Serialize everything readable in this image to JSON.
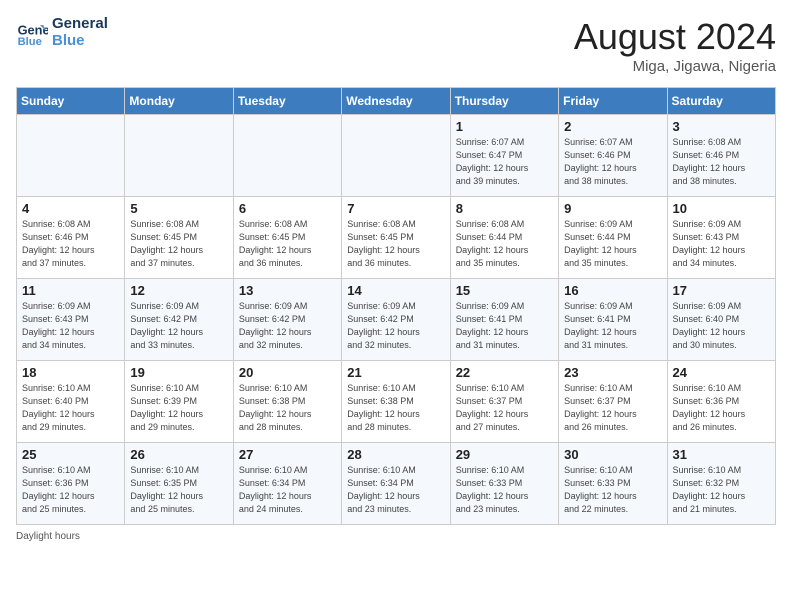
{
  "logo": {
    "line1": "General",
    "line2": "Blue"
  },
  "title": "August 2024",
  "subtitle": "Miga, Jigawa, Nigeria",
  "days_of_week": [
    "Sunday",
    "Monday",
    "Tuesday",
    "Wednesday",
    "Thursday",
    "Friday",
    "Saturday"
  ],
  "weeks": [
    [
      {
        "num": "",
        "info": ""
      },
      {
        "num": "",
        "info": ""
      },
      {
        "num": "",
        "info": ""
      },
      {
        "num": "",
        "info": ""
      },
      {
        "num": "1",
        "info": "Sunrise: 6:07 AM\nSunset: 6:47 PM\nDaylight: 12 hours\nand 39 minutes."
      },
      {
        "num": "2",
        "info": "Sunrise: 6:07 AM\nSunset: 6:46 PM\nDaylight: 12 hours\nand 38 minutes."
      },
      {
        "num": "3",
        "info": "Sunrise: 6:08 AM\nSunset: 6:46 PM\nDaylight: 12 hours\nand 38 minutes."
      }
    ],
    [
      {
        "num": "4",
        "info": "Sunrise: 6:08 AM\nSunset: 6:46 PM\nDaylight: 12 hours\nand 37 minutes."
      },
      {
        "num": "5",
        "info": "Sunrise: 6:08 AM\nSunset: 6:45 PM\nDaylight: 12 hours\nand 37 minutes."
      },
      {
        "num": "6",
        "info": "Sunrise: 6:08 AM\nSunset: 6:45 PM\nDaylight: 12 hours\nand 36 minutes."
      },
      {
        "num": "7",
        "info": "Sunrise: 6:08 AM\nSunset: 6:45 PM\nDaylight: 12 hours\nand 36 minutes."
      },
      {
        "num": "8",
        "info": "Sunrise: 6:08 AM\nSunset: 6:44 PM\nDaylight: 12 hours\nand 35 minutes."
      },
      {
        "num": "9",
        "info": "Sunrise: 6:09 AM\nSunset: 6:44 PM\nDaylight: 12 hours\nand 35 minutes."
      },
      {
        "num": "10",
        "info": "Sunrise: 6:09 AM\nSunset: 6:43 PM\nDaylight: 12 hours\nand 34 minutes."
      }
    ],
    [
      {
        "num": "11",
        "info": "Sunrise: 6:09 AM\nSunset: 6:43 PM\nDaylight: 12 hours\nand 34 minutes."
      },
      {
        "num": "12",
        "info": "Sunrise: 6:09 AM\nSunset: 6:42 PM\nDaylight: 12 hours\nand 33 minutes."
      },
      {
        "num": "13",
        "info": "Sunrise: 6:09 AM\nSunset: 6:42 PM\nDaylight: 12 hours\nand 32 minutes."
      },
      {
        "num": "14",
        "info": "Sunrise: 6:09 AM\nSunset: 6:42 PM\nDaylight: 12 hours\nand 32 minutes."
      },
      {
        "num": "15",
        "info": "Sunrise: 6:09 AM\nSunset: 6:41 PM\nDaylight: 12 hours\nand 31 minutes."
      },
      {
        "num": "16",
        "info": "Sunrise: 6:09 AM\nSunset: 6:41 PM\nDaylight: 12 hours\nand 31 minutes."
      },
      {
        "num": "17",
        "info": "Sunrise: 6:09 AM\nSunset: 6:40 PM\nDaylight: 12 hours\nand 30 minutes."
      }
    ],
    [
      {
        "num": "18",
        "info": "Sunrise: 6:10 AM\nSunset: 6:40 PM\nDaylight: 12 hours\nand 29 minutes."
      },
      {
        "num": "19",
        "info": "Sunrise: 6:10 AM\nSunset: 6:39 PM\nDaylight: 12 hours\nand 29 minutes."
      },
      {
        "num": "20",
        "info": "Sunrise: 6:10 AM\nSunset: 6:38 PM\nDaylight: 12 hours\nand 28 minutes."
      },
      {
        "num": "21",
        "info": "Sunrise: 6:10 AM\nSunset: 6:38 PM\nDaylight: 12 hours\nand 28 minutes."
      },
      {
        "num": "22",
        "info": "Sunrise: 6:10 AM\nSunset: 6:37 PM\nDaylight: 12 hours\nand 27 minutes."
      },
      {
        "num": "23",
        "info": "Sunrise: 6:10 AM\nSunset: 6:37 PM\nDaylight: 12 hours\nand 26 minutes."
      },
      {
        "num": "24",
        "info": "Sunrise: 6:10 AM\nSunset: 6:36 PM\nDaylight: 12 hours\nand 26 minutes."
      }
    ],
    [
      {
        "num": "25",
        "info": "Sunrise: 6:10 AM\nSunset: 6:36 PM\nDaylight: 12 hours\nand 25 minutes."
      },
      {
        "num": "26",
        "info": "Sunrise: 6:10 AM\nSunset: 6:35 PM\nDaylight: 12 hours\nand 25 minutes."
      },
      {
        "num": "27",
        "info": "Sunrise: 6:10 AM\nSunset: 6:34 PM\nDaylight: 12 hours\nand 24 minutes."
      },
      {
        "num": "28",
        "info": "Sunrise: 6:10 AM\nSunset: 6:34 PM\nDaylight: 12 hours\nand 23 minutes."
      },
      {
        "num": "29",
        "info": "Sunrise: 6:10 AM\nSunset: 6:33 PM\nDaylight: 12 hours\nand 23 minutes."
      },
      {
        "num": "30",
        "info": "Sunrise: 6:10 AM\nSunset: 6:33 PM\nDaylight: 12 hours\nand 22 minutes."
      },
      {
        "num": "31",
        "info": "Sunrise: 6:10 AM\nSunset: 6:32 PM\nDaylight: 12 hours\nand 21 minutes."
      }
    ]
  ],
  "footer": "Daylight hours"
}
